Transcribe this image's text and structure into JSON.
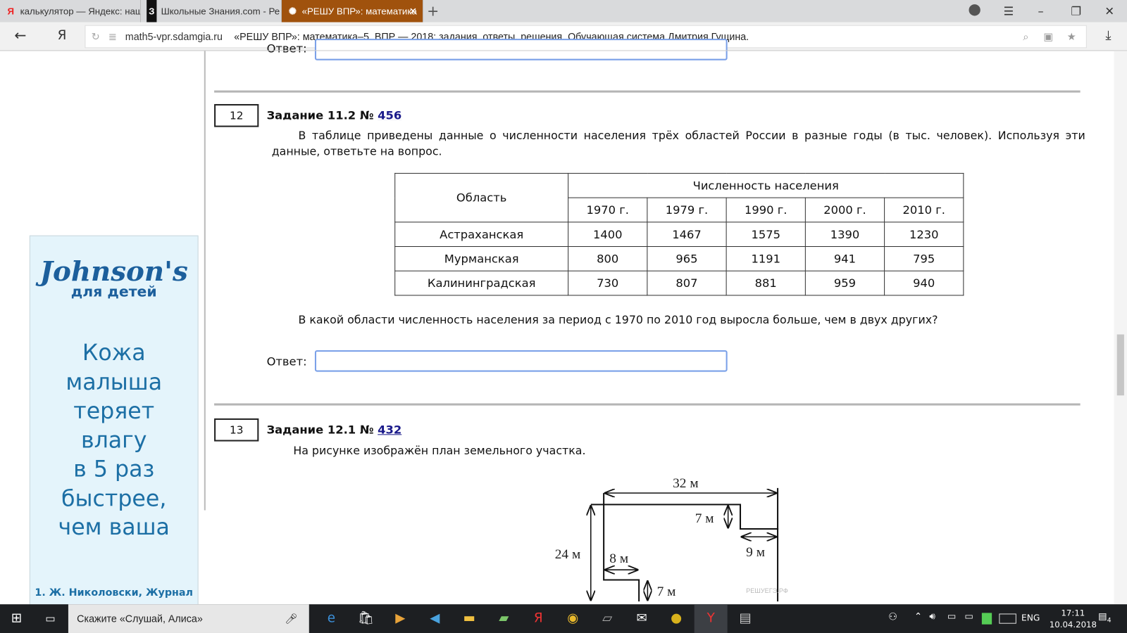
{
  "browser": {
    "tabs": [
      {
        "label": "калькулятор — Яндекс: наш",
        "icon": "yandex-icon"
      },
      {
        "label": "Школьные Знания.com - Ре",
        "icon": "znanija-icon"
      },
      {
        "label": "«РЕШУ ВПР»: математика",
        "icon": "reshu-icon",
        "active": true
      }
    ],
    "url_domain": "math5-vpr.sdamgia.ru",
    "page_title": "«РЕШУ ВПР»: математика–5. ВПР — 2018: задания, ответы, решения. Обучающая система Дмитрия Гущина.",
    "accent": "#a0520d"
  },
  "prev": {
    "answer_label": "Ответ:"
  },
  "task12": {
    "number": "12",
    "title": "Задание 11.2 №",
    "link": "456",
    "text": "В таблице приведены данные о численности населения трёх областей России в разные годы (в тыс. человек). Используя эти данные, ответьте на вопрос.",
    "table": {
      "col_region": "Область",
      "col_group": "Численность населения",
      "years": [
        "1970 г.",
        "1979 г.",
        "1990 г.",
        "2000 г.",
        "2010 г."
      ],
      "rows": [
        {
          "region": "Астраханская",
          "values": [
            "1400",
            "1467",
            "1575",
            "1390",
            "1230"
          ]
        },
        {
          "region": "Мурманская",
          "values": [
            "800",
            "965",
            "1191",
            "941",
            "795"
          ]
        },
        {
          "region": "Калининградская",
          "values": [
            "730",
            "807",
            "881",
            "959",
            "940"
          ]
        }
      ]
    },
    "question": "В какой области численность населения за период с 1970 по 2010 год выросла больше, чем в двух других?",
    "answer_label": "Ответ:",
    "answer_value": ""
  },
  "task13": {
    "number": "13",
    "title": "Задание 12.1 №",
    "link": "432",
    "text": "На рисунке изображён план земельного участка.",
    "figure": {
      "d32": "32 м",
      "d7a": "7 м",
      "d9": "9 м",
      "d24": "24 м",
      "d8": "8 м",
      "d7b": "7 м",
      "watermark": "РЕШУЕГЭ.РФ"
    }
  },
  "ad": {
    "brand": "Johnson's",
    "brand_sub": "для детей",
    "lines": [
      "Кожа",
      "малыша",
      "теряет",
      "влагу",
      "в 5 раз",
      "быстрее,",
      "чем ваша"
    ],
    "footnote": "1. Ж. Николовски, Журнал"
  },
  "taskbar": {
    "search_placeholder": "Скажите «Слушай, Алиса»",
    "lang": "ENG",
    "time": "17:11",
    "date": "10.04.2018",
    "notifications": "4"
  }
}
